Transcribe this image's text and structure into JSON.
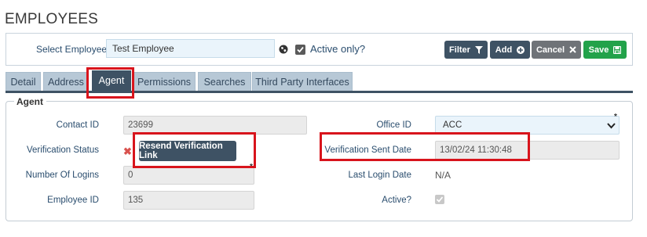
{
  "page": {
    "title": "EMPLOYEES"
  },
  "employee_select": {
    "label": "Select Employee:",
    "value": "Test Employee",
    "active_only_label": "Active only?",
    "active_only_checked": true
  },
  "actions": {
    "filter_label": "Filter",
    "add_label": "Add",
    "cancel_label": "Cancel",
    "save_label": "Save"
  },
  "tabs": [
    {
      "label": "Detail",
      "active": false
    },
    {
      "label": "Address",
      "active": false
    },
    {
      "label": "Agent",
      "active": true
    },
    {
      "label": "Permissions",
      "active": false
    },
    {
      "label": "Searches",
      "active": false
    },
    {
      "label": "Third Party Interfaces",
      "active": false
    }
  ],
  "agent": {
    "legend": "Agent",
    "contact_id_label": "Contact ID",
    "contact_id": "23699",
    "verification_status_label": "Verification Status",
    "resend_label": "Resend Verification Link",
    "number_of_logins_label": "Number Of Logins",
    "number_of_logins": "0",
    "employee_id_label": "Employee ID",
    "employee_id": "135",
    "office_id_label": "Office ID",
    "office_id": "ACC",
    "verification_sent_date_label": "Verification Sent Date",
    "verification_sent_date": "13/02/24 11:30:48",
    "last_login_date_label": "Last Login Date",
    "last_login_date": "N/A",
    "active_label": "Active?",
    "active_checked": true
  },
  "colors": {
    "primary_button": "#3e5264",
    "save_button": "#22a24a",
    "cancel_button": "#6f7378",
    "highlight": "#d8141c",
    "label_text": "#2a4d6e"
  }
}
